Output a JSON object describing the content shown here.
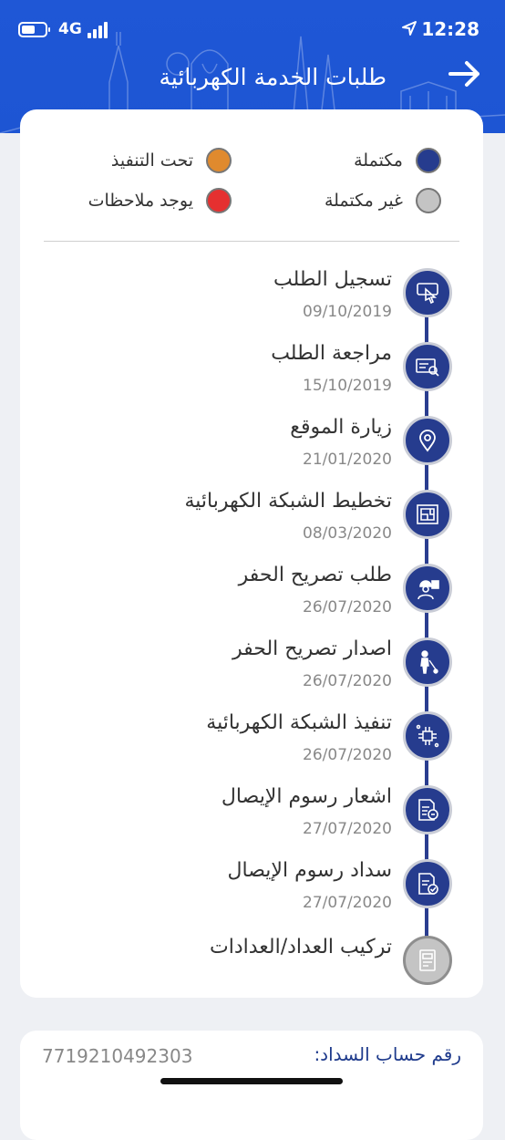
{
  "status_bar": {
    "network": "4G",
    "time": "12:28"
  },
  "header": {
    "title": "طلبات الخدمة الكهربائية"
  },
  "legend": [
    {
      "label": "مكتملة",
      "color": "#263c8e"
    },
    {
      "label": "تحت التنفيذ",
      "color": "#e08a2e"
    },
    {
      "label": "غير مكتملة",
      "color": "#c4c4c4"
    },
    {
      "label": "يوجد ملاحظات",
      "color": "#e53030"
    }
  ],
  "steps": [
    {
      "title": "تسجيل الطلب",
      "date": "09/10/2019",
      "icon": "touch-icon",
      "status": "complete"
    },
    {
      "title": "مراجعة الطلب",
      "date": "15/10/2019",
      "icon": "review-icon",
      "status": "complete"
    },
    {
      "title": "زيارة الموقع",
      "date": "21/01/2020",
      "icon": "location-icon",
      "status": "complete"
    },
    {
      "title": "تخطيط الشبكة الكهربائية",
      "date": "08/03/2020",
      "icon": "blueprint-icon",
      "status": "complete"
    },
    {
      "title": "طلب تصريح الحفر",
      "date": "26/07/2020",
      "icon": "worker-icon",
      "status": "complete"
    },
    {
      "title": "اصدار تصريح الحفر",
      "date": "26/07/2020",
      "icon": "digging-icon",
      "status": "complete"
    },
    {
      "title": "تنفيذ الشبكة الكهربائية",
      "date": "26/07/2020",
      "icon": "circuit-icon",
      "status": "complete"
    },
    {
      "title": "اشعار رسوم الإيصال",
      "date": "27/07/2020",
      "icon": "invoice-icon",
      "status": "complete"
    },
    {
      "title": "سداد رسوم الإيصال",
      "date": "27/07/2020",
      "icon": "paid-invoice-icon",
      "status": "complete"
    },
    {
      "title": "تركيب العداد/العدادات",
      "date": "",
      "icon": "meter-icon",
      "status": "incomplete"
    }
  ],
  "account": {
    "label": "رقم حساب السداد:",
    "value": "7719210492303"
  }
}
